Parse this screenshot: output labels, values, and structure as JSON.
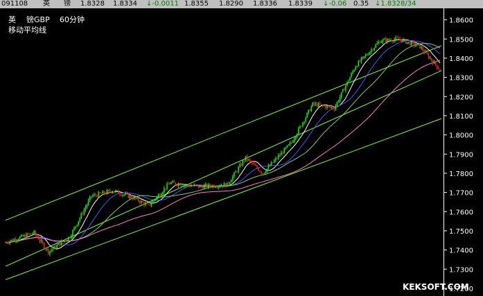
{
  "ticker": {
    "date": "091108",
    "name_cn": "英",
    "name_cn2": "镑",
    "open": "1.8328",
    "high": "1.8334",
    "change": "↓-0.0011",
    "v1": "1.8355",
    "v2": "1.8290",
    "v3": "1.8336",
    "v4": "1.8339",
    "change2": "↓-0.06",
    "v5": "0.35",
    "last": "↓1.8328/34"
  },
  "chart_label": {
    "line1_a": "英",
    "line1_b": "镑GBP",
    "line1_c": "60分钟",
    "line2": "移动平均线"
  },
  "watermark": "KEKSOFT.COM",
  "colors": {
    "background": "#000000",
    "up_candle": "#00ff00",
    "down_candle": "#ff2020",
    "ma_short": "#ffffff",
    "ma_mid": "#5050ff",
    "ma_long": "#ff80c0",
    "trend_line": "#7cff2a"
  },
  "chart_data": {
    "type": "candlestick",
    "title": "",
    "xlabel": "",
    "ylabel": "",
    "ylim": [
      1.716,
      1.866
    ],
    "ticks": [
      "1.8600",
      "1.8500",
      "1.8400",
      "1.8300",
      "1.8200",
      "1.8100",
      "1.8000",
      "1.7900",
      "1.7800",
      "1.7700",
      "1.7600",
      "1.7500",
      "1.7400",
      "1.7300",
      "1.7200"
    ],
    "key_levels": [
      {
        "bar": 0,
        "price": 1.744
      },
      {
        "bar": 20,
        "price": 1.749
      },
      {
        "bar": 30,
        "price": 1.739
      },
      {
        "bar": 45,
        "price": 1.747
      },
      {
        "bar": 60,
        "price": 1.768
      },
      {
        "bar": 75,
        "price": 1.771
      },
      {
        "bar": 90,
        "price": 1.767
      },
      {
        "bar": 100,
        "price": 1.763
      },
      {
        "bar": 115,
        "price": 1.775
      },
      {
        "bar": 135,
        "price": 1.773
      },
      {
        "bar": 155,
        "price": 1.774
      },
      {
        "bar": 168,
        "price": 1.788
      },
      {
        "bar": 180,
        "price": 1.78
      },
      {
        "bar": 200,
        "price": 1.796
      },
      {
        "bar": 215,
        "price": 1.816
      },
      {
        "bar": 230,
        "price": 1.814
      },
      {
        "bar": 245,
        "price": 1.836
      },
      {
        "bar": 262,
        "price": 1.849
      },
      {
        "bar": 275,
        "price": 1.85
      },
      {
        "bar": 290,
        "price": 1.846
      },
      {
        "bar": 305,
        "price": 1.833
      }
    ],
    "bars": 305,
    "trend_lines": [
      {
        "from": [
          0,
          1.7555
        ],
        "to": [
          305,
          1.8465
        ]
      },
      {
        "from": [
          0,
          1.7315
        ],
        "to": [
          305,
          1.8335
        ]
      },
      {
        "from": [
          0,
          1.7245
        ],
        "to": [
          305,
          1.8085
        ]
      }
    ]
  }
}
